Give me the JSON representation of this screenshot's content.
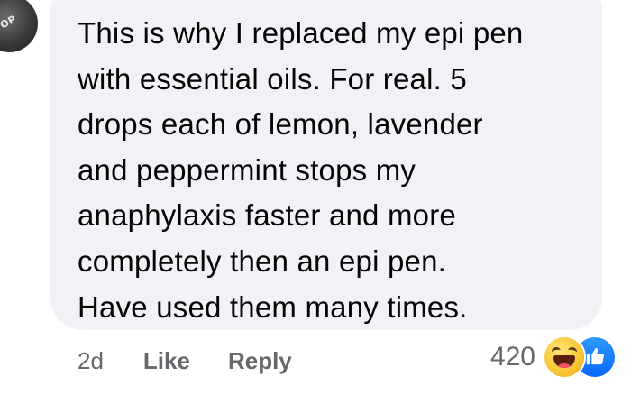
{
  "comment": {
    "avatar_label": "OP",
    "text": "This is why I replaced my epi pen\nwith essential oils. For real. 5\ndrops each of lemon, lavender\nand peppermint stops my\nanaphylaxis faster and more\ncompletely then an epi pen.\nHave used them many times.",
    "bubble_color": "#f0f2f5",
    "text_color": "#050505"
  },
  "actions": {
    "timestamp": "2d",
    "like_label": "Like",
    "reply_label": "Reply",
    "meta_color": "#65676b"
  },
  "reactions": {
    "count": "420",
    "icons": [
      "haha-icon",
      "like-icon"
    ],
    "like_color": "#0866ff",
    "haha_color": "#f7c531"
  }
}
